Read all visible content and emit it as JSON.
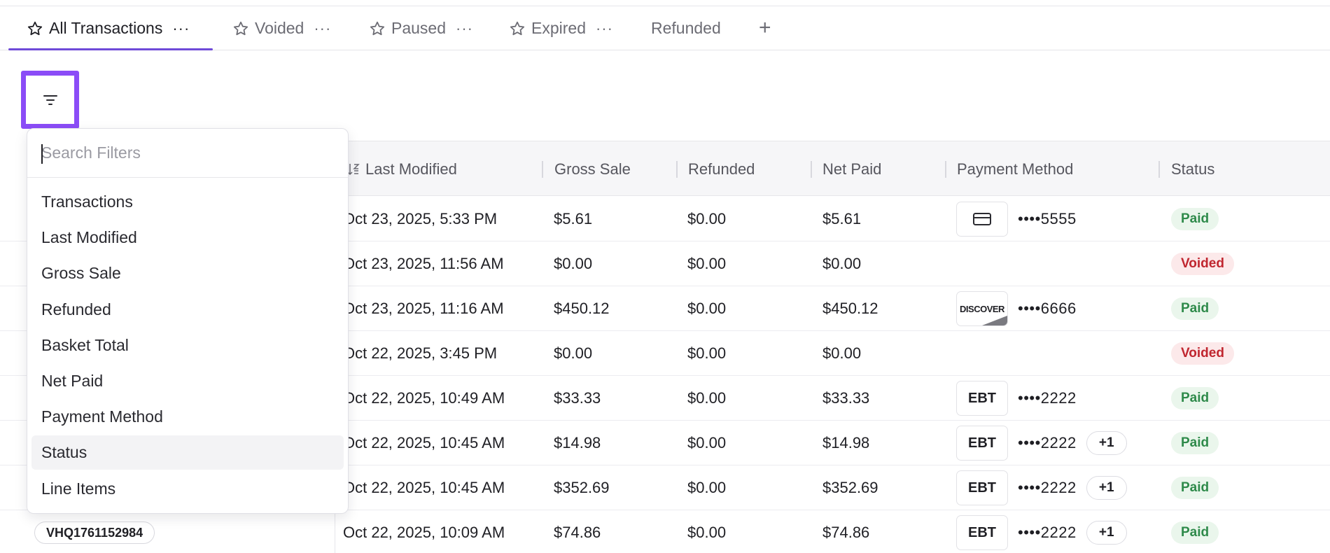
{
  "tabs": [
    {
      "label": "All Transactions",
      "starred": true,
      "active": true
    },
    {
      "label": "Voided",
      "starred": true
    },
    {
      "label": "Paused",
      "starred": true
    },
    {
      "label": "Expired",
      "starred": true
    },
    {
      "label": "Refunded",
      "starred": false
    }
  ],
  "tab_more": "···",
  "tab_add": "+",
  "filter_button": {
    "icon": "filter-lines-icon"
  },
  "dropdown": {
    "placeholder": "Search Filters",
    "items": [
      "Transactions",
      "Last Modified",
      "Gross Sale",
      "Refunded",
      "Basket Total",
      "Net Paid",
      "Payment Method",
      "Status",
      "Line Items"
    ],
    "hovered": "Status"
  },
  "columns": [
    "Last Modified",
    "Gross Sale",
    "Refunded",
    "Net Paid",
    "Payment Method",
    "Status"
  ],
  "rows": [
    {
      "modified": "Oct 23, 2025, 5:33 PM",
      "gross": "$5.61",
      "refunded": "$0.00",
      "net": "$5.61",
      "pm": "card",
      "pm_label": "",
      "last4": "••••5555",
      "extra": "",
      "status": "Paid"
    },
    {
      "modified": "Oct 23, 2025, 11:56 AM",
      "gross": "$0.00",
      "refunded": "$0.00",
      "net": "$0.00",
      "pm": "",
      "pm_label": "",
      "last4": "",
      "extra": "",
      "status": "Voided"
    },
    {
      "modified": "Oct 23, 2025, 11:16 AM",
      "gross": "$450.12",
      "refunded": "$0.00",
      "net": "$450.12",
      "pm": "discover",
      "pm_label": "DISCOVER",
      "last4": "••••6666",
      "extra": "",
      "status": "Paid"
    },
    {
      "modified": "Oct 22, 2025, 3:45 PM",
      "gross": "$0.00",
      "refunded": "$0.00",
      "net": "$0.00",
      "pm": "",
      "pm_label": "",
      "last4": "",
      "extra": "",
      "status": "Voided"
    },
    {
      "modified": "Oct 22, 2025, 10:49 AM",
      "gross": "$33.33",
      "refunded": "$0.00",
      "net": "$33.33",
      "pm": "ebt",
      "pm_label": "EBT",
      "last4": "••••2222",
      "extra": "",
      "status": "Paid"
    },
    {
      "modified": "Oct 22, 2025, 10:45 AM",
      "gross": "$14.98",
      "refunded": "$0.00",
      "net": "$14.98",
      "pm": "ebt",
      "pm_label": "EBT",
      "last4": "••••2222",
      "extra": "+1",
      "status": "Paid"
    },
    {
      "modified": "Oct 22, 2025, 10:45 AM",
      "gross": "$352.69",
      "refunded": "$0.00",
      "net": "$352.69",
      "pm": "ebt",
      "pm_label": "EBT",
      "last4": "••••2222",
      "extra": "+1",
      "status": "Paid"
    },
    {
      "modified": "Oct 22, 2025, 10:09 AM",
      "gross": "$74.86",
      "refunded": "$0.00",
      "net": "$74.86",
      "pm": "ebt",
      "pm_label": "EBT",
      "last4": "••••2222",
      "extra": "+1",
      "status": "Paid",
      "txn": "VHQ1761152984"
    }
  ],
  "colors": {
    "accent": "#6f4ad8",
    "highlight": "#8b4cf7",
    "paid_bg": "#eaf6ec",
    "paid_fg": "#2e8a4a",
    "voided_bg": "#fce9ea",
    "voided_fg": "#c0262f"
  }
}
